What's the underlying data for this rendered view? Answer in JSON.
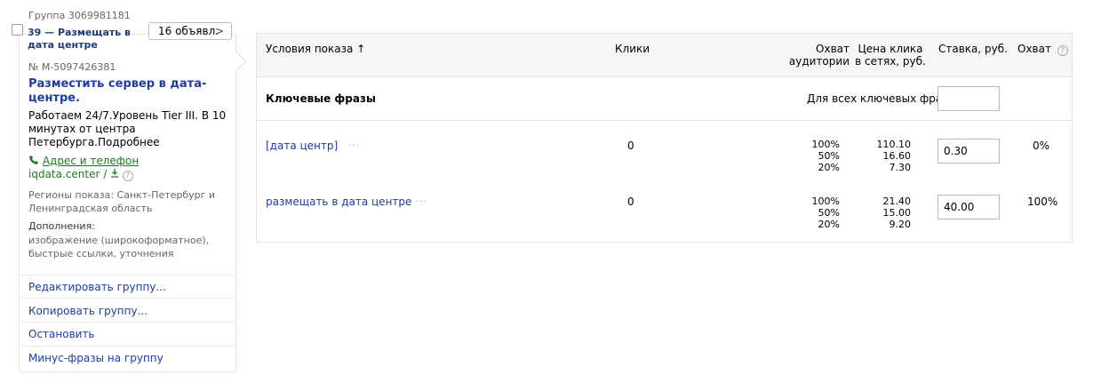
{
  "group": {
    "label": "Группа 3069981181",
    "number_title": "39 — Размещать в дата центре",
    "ads_button": "16 объявл.",
    "ads_chevron": ">"
  },
  "ad": {
    "number": "№ M-5097426381",
    "title": "Разместить сервер в дата-центре.",
    "text": "Работаем 24/7.Уровень Tier III. В 10 минутах от центра Петербурга.Подробнее",
    "address_label": "Адрес и телефон",
    "domain": "iqdata.center /",
    "regions": "Регионы показа: Санкт-Петербург и Ленинградская область",
    "extras_label": "Дополнения:",
    "extras_text": "изображение (широкоформатное), быстрые ссылки, уточнения"
  },
  "actions": {
    "edit": "Редактировать группу...",
    "copy": "Копировать группу...",
    "stop": "Остановить",
    "minus": "Минус-фразы на группу"
  },
  "table": {
    "headers": {
      "conditions": "Условия показа ↑",
      "clicks": "Клики",
      "reach": "Охват аудитории",
      "price": "Цена клика в сетях, руб.",
      "bid": "Ставка, руб.",
      "coverage": "Охват"
    },
    "keywords_header": "Ключевые фразы",
    "all_keywords_label": "Для всех ключевых фраз:",
    "all_keywords_value": "",
    "rows": [
      {
        "phrase": "[дата центр]",
        "more": "···",
        "clicks": "0",
        "reach": [
          "100%",
          "50%",
          "20%"
        ],
        "price": [
          "110.10",
          "16.60",
          "7.30"
        ],
        "bid": "0.30",
        "coverage": "0%"
      },
      {
        "phrase": "размещать в дата центре",
        "more": "···",
        "clicks": "0",
        "reach": [
          "100%",
          "50%",
          "20%"
        ],
        "price": [
          "21.40",
          "15.00",
          "9.20"
        ],
        "bid": "40.00",
        "coverage": "100%"
      }
    ]
  },
  "icons": {
    "phone": "phone-icon",
    "vcard": "vcard-icon",
    "help": "help-icon"
  },
  "colors": {
    "link": "#1f3ca6",
    "green_link": "#1f7a1f",
    "muted": "#666666",
    "border": "#e3e3e3"
  }
}
